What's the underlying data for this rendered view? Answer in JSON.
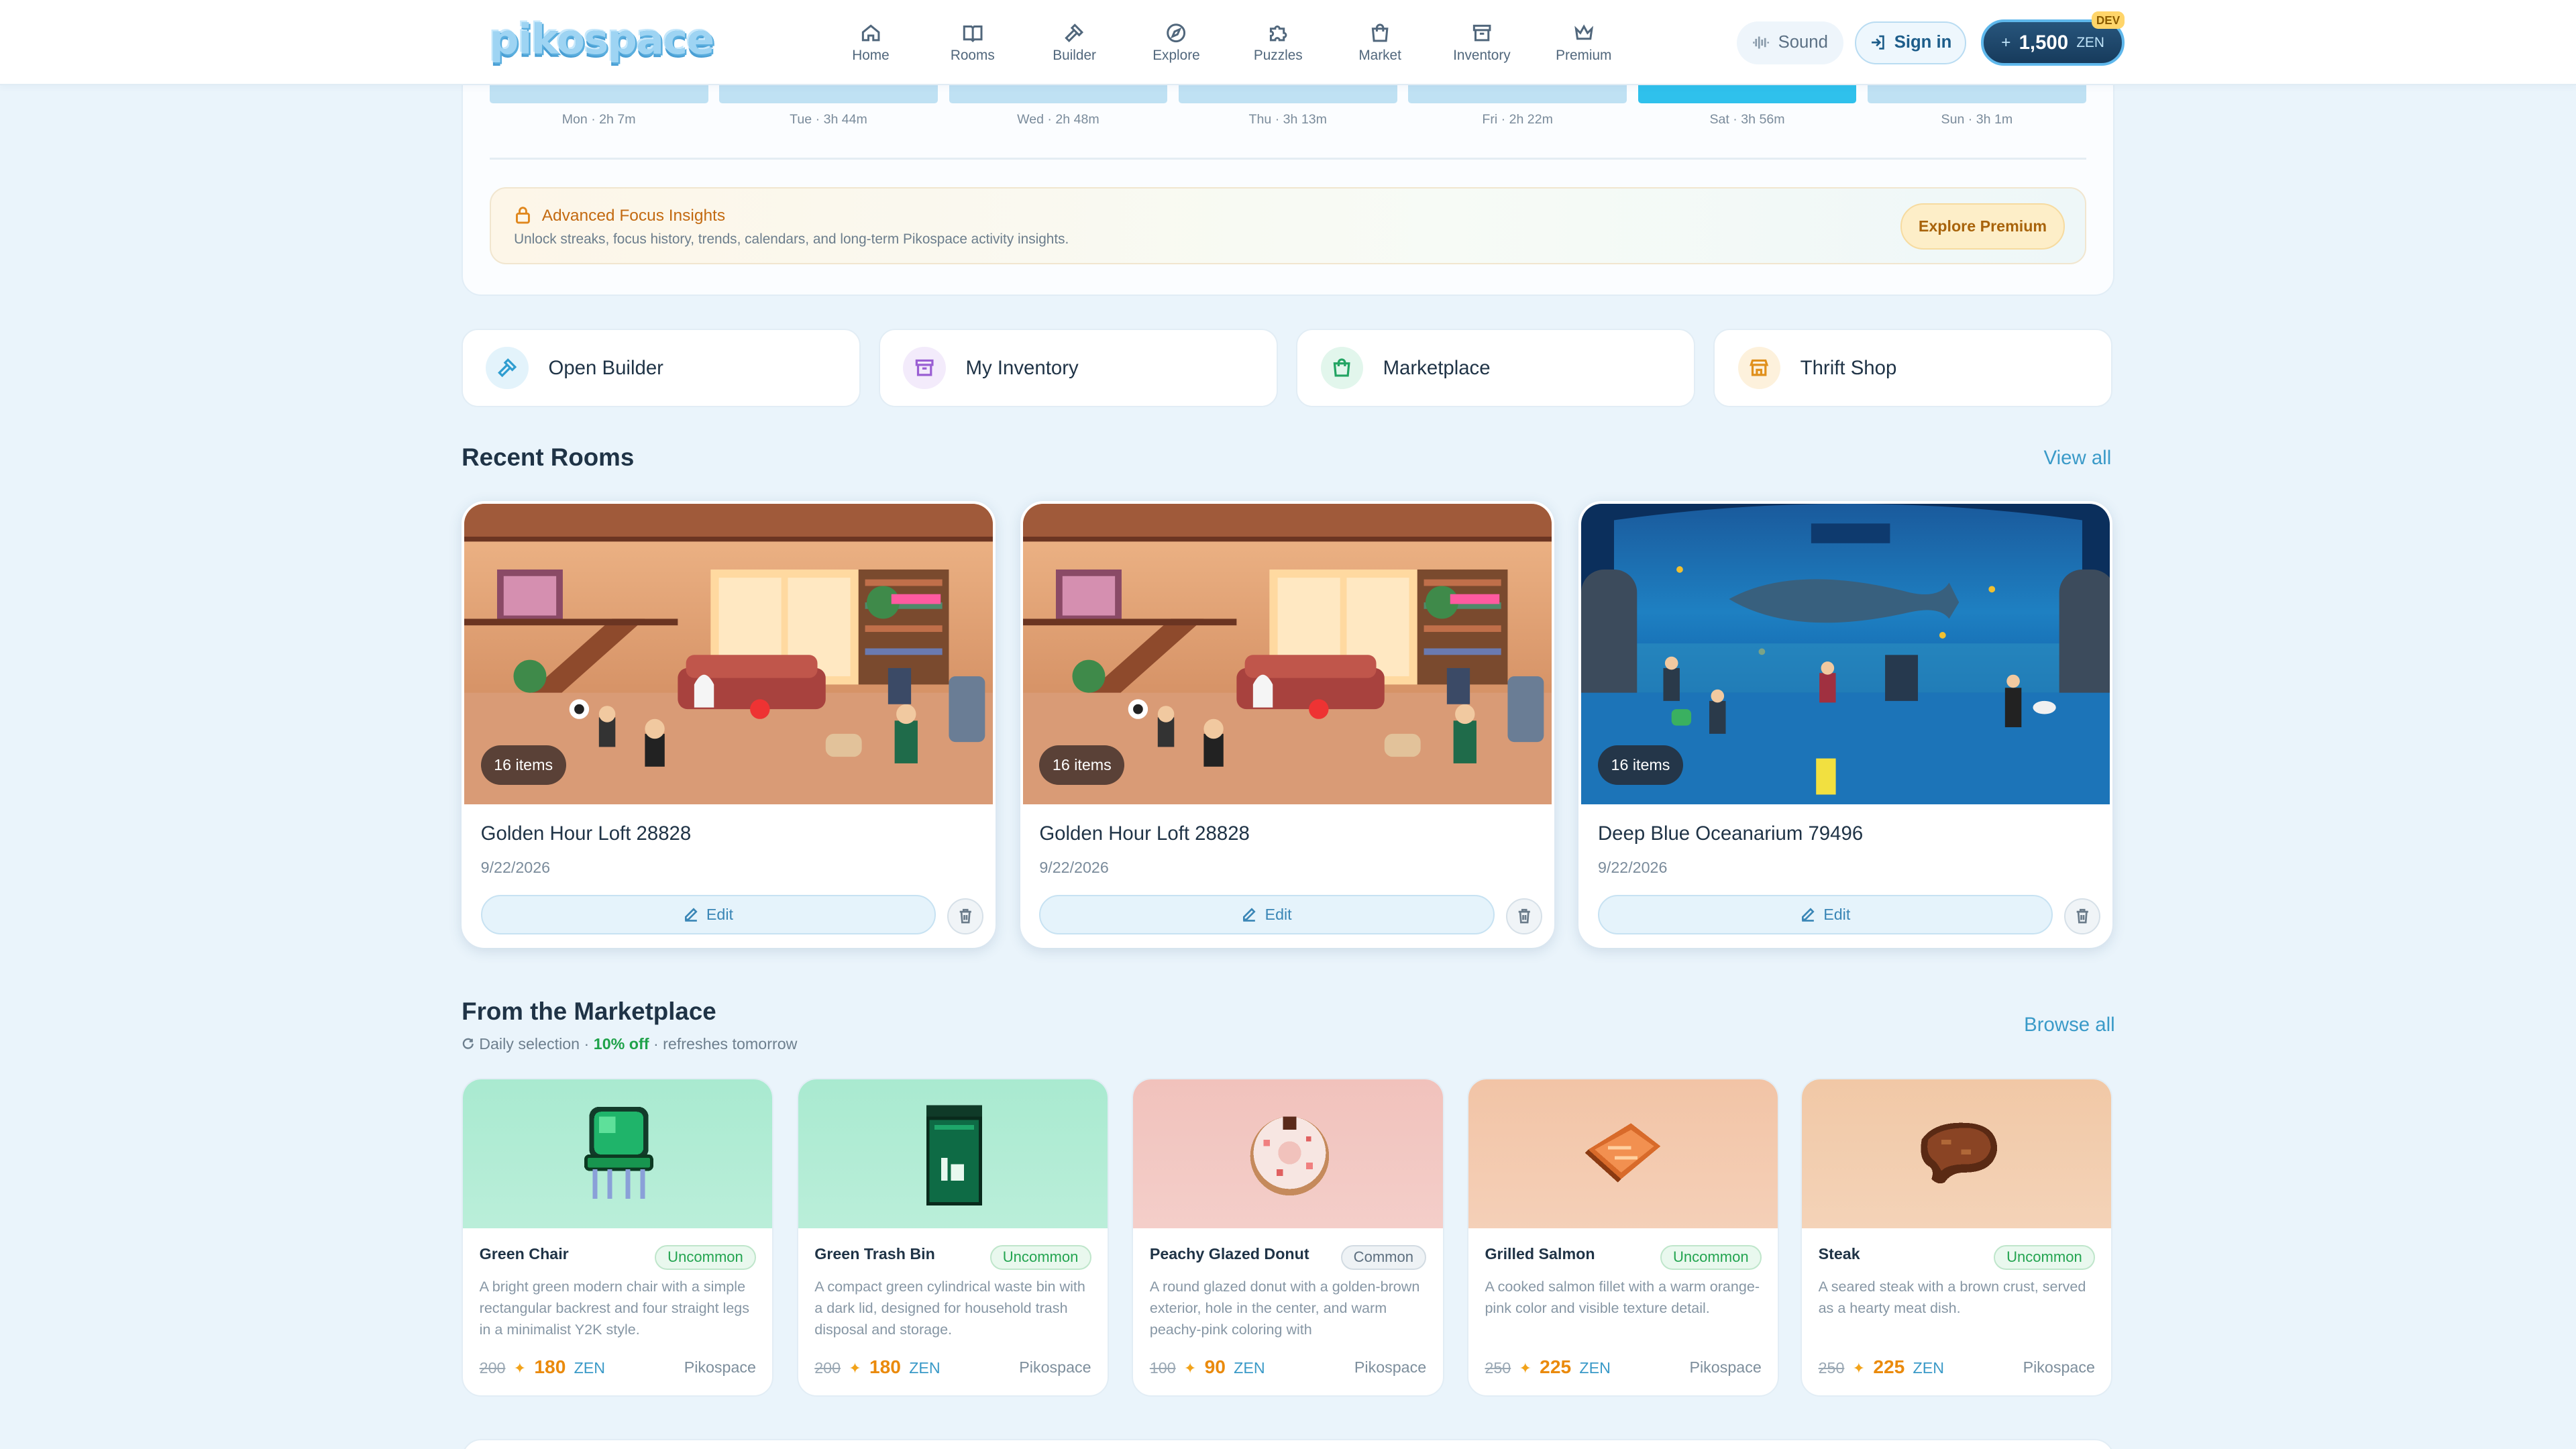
{
  "brand": {
    "logo": "pikospace"
  },
  "nav": [
    {
      "label": "Home",
      "icon": "home-icon"
    },
    {
      "label": "Rooms",
      "icon": "book-icon"
    },
    {
      "label": "Builder",
      "icon": "hammer-icon"
    },
    {
      "label": "Explore",
      "icon": "compass-icon"
    },
    {
      "label": "Puzzles",
      "icon": "puzzle-icon"
    },
    {
      "label": "Market",
      "icon": "shopping-bag-icon"
    },
    {
      "label": "Inventory",
      "icon": "archive-icon"
    },
    {
      "label": "Premium",
      "icon": "crown-icon"
    }
  ],
  "header": {
    "sound_label": "Sound",
    "signin_label": "Sign in",
    "zen_plus": "+",
    "zen_amount": "1,500",
    "zen_unit": "ZEN",
    "dev_badge": "DEV"
  },
  "focus": {
    "days": [
      {
        "label": "Mon · 2h 7m",
        "active": false
      },
      {
        "label": "Tue · 3h 44m",
        "active": false
      },
      {
        "label": "Wed · 2h 48m",
        "active": false
      },
      {
        "label": "Thu · 3h 13m",
        "active": false
      },
      {
        "label": "Fri · 2h 22m",
        "active": false
      },
      {
        "label": "Sat · 3h 56m",
        "active": true
      },
      {
        "label": "Sun · 3h 1m",
        "active": false
      }
    ],
    "insights_title": "Advanced Focus Insights",
    "insights_sub": "Unlock streaks, focus history, trends, calendars, and long-term Pikospace activity insights.",
    "explore_premium": "Explore Premium"
  },
  "quick_actions": [
    {
      "label": "Open Builder",
      "icon": "hammer-icon"
    },
    {
      "label": "My Inventory",
      "icon": "archive-icon"
    },
    {
      "label": "Marketplace",
      "icon": "shopping-bag-icon"
    },
    {
      "label": "Thrift Shop",
      "icon": "store-icon"
    }
  ],
  "recent_rooms": {
    "title": "Recent Rooms",
    "view_all": "View all",
    "edit_label": "Edit",
    "rooms": [
      {
        "name": "Golden Hour Loft 28828",
        "date": "9/22/2026",
        "items": "16 items",
        "theme": "loft"
      },
      {
        "name": "Golden Hour Loft 28828",
        "date": "9/22/2026",
        "items": "16 items",
        "theme": "loft"
      },
      {
        "name": "Deep Blue Oceanarium 79496",
        "date": "9/22/2026",
        "items": "16 items",
        "theme": "ocean"
      }
    ]
  },
  "marketplace": {
    "title": "From the Marketplace",
    "sub_prefix": "Daily selection ·",
    "sub_discount": "10% off",
    "sub_suffix": "· refreshes tomorrow",
    "browse_all": "Browse all",
    "currency": "ZEN",
    "items": [
      {
        "name": "Green Chair",
        "rarity": "Uncommon",
        "desc": "A bright green modern chair with a simple rectangular backrest and four straight legs in a minimalist Y2K style.",
        "old_price": "200",
        "price": "180",
        "seller": "Pikospace",
        "bg": "#a9ead0",
        "art": "chair"
      },
      {
        "name": "Green Trash Bin",
        "rarity": "Uncommon",
        "desc": "A compact green cylindrical waste bin with a dark lid, designed for household trash disposal and storage.",
        "old_price": "200",
        "price": "180",
        "seller": "Pikospace",
        "bg": "#a9ead0",
        "art": "bin"
      },
      {
        "name": "Peachy Glazed Donut",
        "rarity": "Common",
        "desc": "A round glazed donut with a golden-brown exterior, hole in the center, and warm peachy-pink coloring with",
        "old_price": "100",
        "price": "90",
        "seller": "Pikospace",
        "bg": "#f1c2bc",
        "art": "donut"
      },
      {
        "name": "Grilled Salmon",
        "rarity": "Uncommon",
        "desc": "A cooked salmon fillet with a warm orange-pink color and visible texture detail.",
        "old_price": "250",
        "price": "225",
        "seller": "Pikospace",
        "bg": "#f2c4a6",
        "art": "salmon"
      },
      {
        "name": "Steak",
        "rarity": "Uncommon",
        "desc": "A seared steak with a brown crust, served as a hearty meat dish.",
        "old_price": "250",
        "price": "225",
        "seller": "Pikospace",
        "bg": "#f1c8a6",
        "art": "steak"
      }
    ]
  }
}
